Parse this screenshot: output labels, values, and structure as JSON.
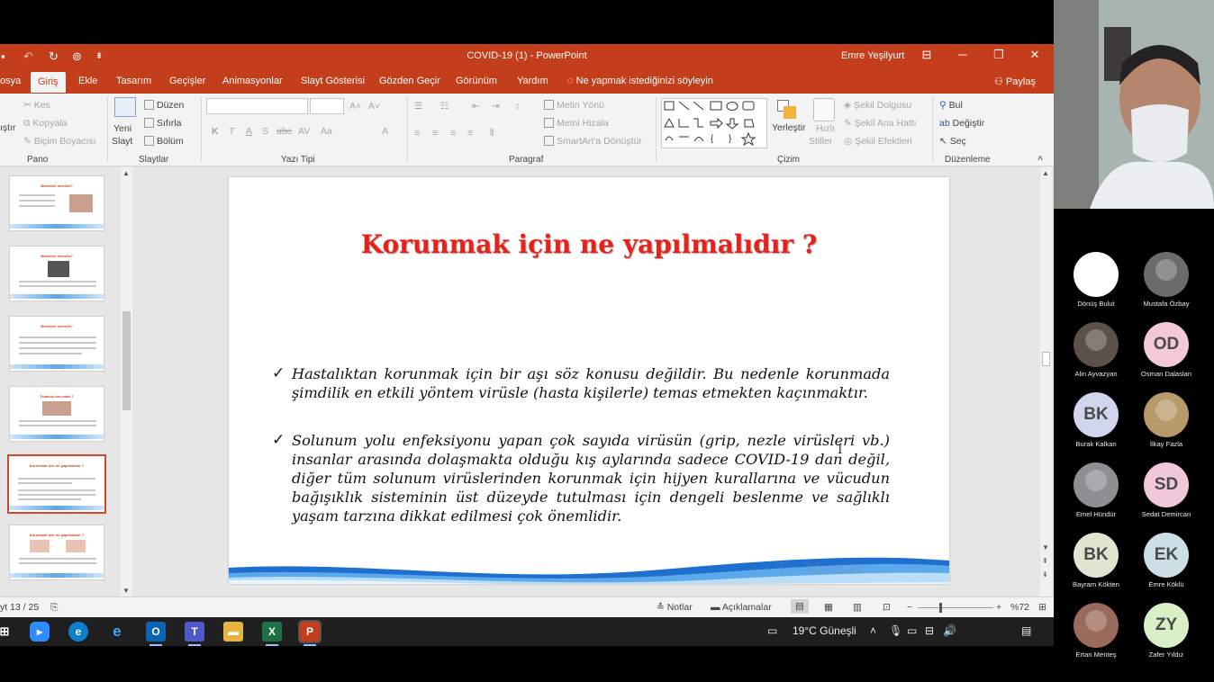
{
  "titlebar": {
    "doc_title": "COVID-19 (1)  -  PowerPoint",
    "user": "Emre Yeşilyurt",
    "btn_minimize": "─",
    "btn_restore": "❐",
    "btn_close": "✕",
    "quick_save": "▪",
    "quick_undo": "↶",
    "quick_redo": "↻",
    "quick_present": "⊚",
    "quick_more": "⇟"
  },
  "tabs": [
    "osya",
    "Giriş",
    "Ekle",
    "Tasarım",
    "Geçişler",
    "Animasyonlar",
    "Slayt Gösterisi",
    "Gözden Geçir",
    "Görünüm",
    "Yardım"
  ],
  "tell_me": "Ne yapmak istediğinizi söyleyin",
  "share": "Paylaş",
  "ribbon": {
    "clipboard": {
      "paste": "ıştır",
      "cut": "Kes",
      "copy": "Kopyala",
      "format_painter": "Biçim Boyacısı",
      "label": "Pano"
    },
    "slides": {
      "new_slide_1": "Yeni",
      "new_slide_2": "Slayt",
      "layout": "Düzen",
      "reset": "Sıfırla",
      "section": "Bölüm",
      "label": "Slaytlar"
    },
    "font": {
      "label": "Yazı Tipi",
      "bold": "K",
      "italic": "T",
      "underline": "A",
      "shadow": "S",
      "strike": "abc",
      "spacing": "AV",
      "case": "Aa",
      "grow": "A˄",
      "shrink": "A˅",
      "color": "A"
    },
    "paragraph": {
      "label": "Paragraf",
      "text_direction": "Metin Yönü",
      "align_text": "Metni Hizala",
      "smartart": "SmartArt'a Dönüştür"
    },
    "drawing": {
      "label": "Çizim",
      "arrange": "Yerleştir",
      "quick_styles_1": "Hızlı",
      "quick_styles_2": "Stiller",
      "shape_fill": "Şekil Dolgusu",
      "shape_outline": "Şekil Ana Hattı",
      "shape_effects": "Şekil Efektleri"
    },
    "editing": {
      "label": "Düzenleme",
      "find": "Bul",
      "replace": "Değiştir",
      "select": "Seç"
    }
  },
  "thumbnails": [
    {
      "title": "Belirtileri nelerdir?"
    },
    {
      "title": "Belirtileri nelerdir?"
    },
    {
      "title": "Belirtileri nelerdir?"
    },
    {
      "title": "Tedavisi var mıdır ?"
    },
    {
      "title": "Korunmak için ne yapılmalıdır ?"
    },
    {
      "title": "Korunmak için ne yapılmalıdır ?"
    }
  ],
  "slide": {
    "title": "Korunmak için ne yapılmalıdır ?",
    "bullets": [
      "Hastalıktan korunmak için bir aşı söz konusu değildir. Bu nedenle korunmada şimdilik en etkili yöntem virüsle (hasta kişilerle) temas etmekten kaçınmaktır.",
      "Solunum yolu enfeksiyonu yapan çok sayıda virüsün (grip, nezle virüsleri vb.) insanlar arasında dolaşmakta olduğu kış aylarında sadece COVID-19 dan değil, diğer tüm solunum virüslerinden korunmak için hijyen kurallarına ve vücudun bağışıklık sisteminin üst düzeyde tutulması için dengeli beslenme ve sağlıklı yaşam tarzına dikkat edilmesi çok önemlidir."
    ],
    "check": "✓",
    "watermark": "Tz Medal"
  },
  "statusbar": {
    "slide_counter": "yt 13 / 25",
    "notes": "Notlar",
    "comments": "Açıklamalar",
    "zoom": "%72",
    "zoom_level": 0.72
  },
  "taskbar": {
    "weather": "19°C  Güneşli",
    "icons": [
      "windows-icon",
      "zoom-icon",
      "edge-icon",
      "ie-icon",
      "outlook-icon",
      "teams-icon",
      "explorer-icon",
      "excel-icon",
      "powerpoint-icon"
    ]
  },
  "participants": [
    {
      "name": "Dönüş Bulut",
      "initials": "",
      "color": "#ffffff",
      "kind": "photo"
    },
    {
      "name": "Mustafa Özbay",
      "initials": "",
      "color": "#6c6c6c",
      "kind": "photo"
    },
    {
      "name": "Alin Ayvazyan",
      "initials": "",
      "color": "#5c5048",
      "kind": "photo"
    },
    {
      "name": "Osman Dalaslan",
      "initials": "OD",
      "color": "#f3c9d8",
      "kind": "initials"
    },
    {
      "name": "Burak Kalkan",
      "initials": "BK",
      "color": "#d0d6ee",
      "kind": "initials"
    },
    {
      "name": "İlkay Fazla",
      "initials": "",
      "color": "#b89a6a",
      "kind": "photo"
    },
    {
      "name": "Emel Hündür",
      "initials": "",
      "color": "#8c8f94",
      "kind": "photo"
    },
    {
      "name": "Sedat Demircan",
      "initials": "SD",
      "color": "#f0c8d9",
      "kind": "initials"
    },
    {
      "name": "Bayram Kökten",
      "initials": "BK",
      "color": "#dfe6cf",
      "kind": "initials"
    },
    {
      "name": "Emre Köklü",
      "initials": "EK",
      "color": "#cddfe6",
      "kind": "initials"
    },
    {
      "name": "Ertan Menteş",
      "initials": "",
      "color": "#9a6a5a",
      "kind": "photo"
    },
    {
      "name": "Zafer Yıldız",
      "initials": "ZY",
      "color": "#d8efc8",
      "kind": "initials"
    }
  ],
  "colors": {
    "ppt_accent": "#c43e1c",
    "slide_title": "#e8221a",
    "taskbar": "#1f1f1f"
  }
}
